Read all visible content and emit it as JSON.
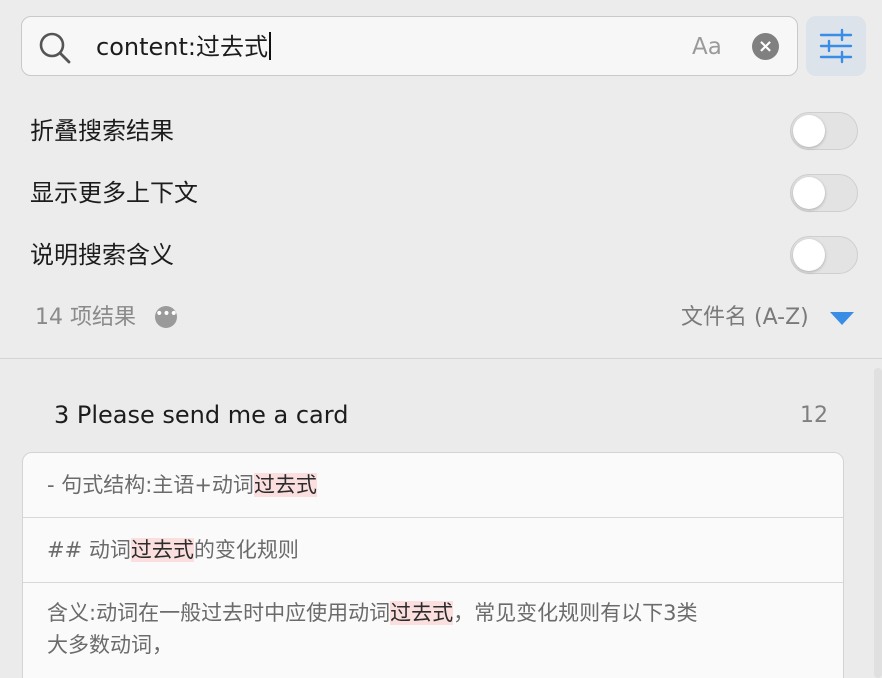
{
  "search": {
    "query": "content:过去式",
    "case_toggle_label": "Aa",
    "clear_glyph": "×"
  },
  "options": [
    {
      "label": "折叠搜索结果",
      "enabled": false
    },
    {
      "label": "显示更多上下文",
      "enabled": false
    },
    {
      "label": "说明搜索含义",
      "enabled": false
    }
  ],
  "results_summary": {
    "count_label": "14 项结果",
    "more_glyph": "•••"
  },
  "sort": {
    "label": "文件名 (A-Z)"
  },
  "result_files": [
    {
      "title": "3 Please send me a card",
      "match_count": "12",
      "matches": [
        {
          "before": "- 句式结构:主语+动词",
          "highlight": "过去式",
          "after": ""
        },
        {
          "before": "## 动词",
          "highlight": "过去式",
          "after": "的变化规则"
        },
        {
          "before": "含义:动词在一般过去时中应使用动词",
          "highlight": "过去式",
          "after": "，常见变化规则有以下3类",
          "line2": "大多数动词，"
        }
      ]
    }
  ],
  "colors": {
    "accent": "#3a8de6",
    "highlight_bg": "#fbdfdf",
    "filter_button_bg": "#dde3ea"
  }
}
